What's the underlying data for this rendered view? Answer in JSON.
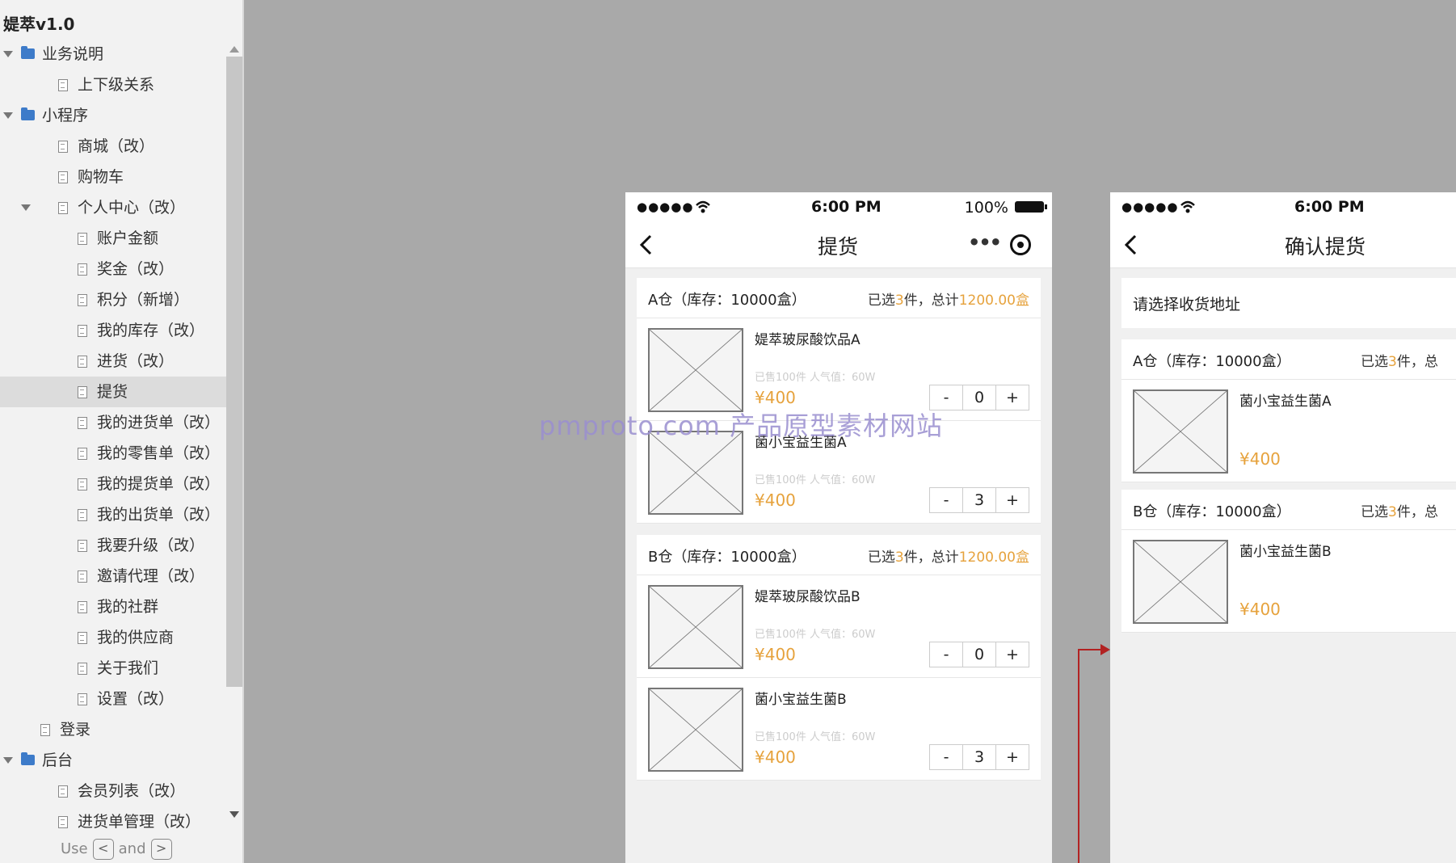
{
  "sidebar": {
    "title": "媞萃v1.0",
    "items": [
      {
        "label": "业务说明",
        "type": "folder",
        "level": 0,
        "expanded": true
      },
      {
        "label": "上下级关系",
        "type": "page",
        "level": 1
      },
      {
        "label": "小程序",
        "type": "folder",
        "level": 0,
        "expanded": true
      },
      {
        "label": "商城（改）",
        "type": "page",
        "level": 1
      },
      {
        "label": "购物车",
        "type": "page",
        "level": 1
      },
      {
        "label": "个人中心（改）",
        "type": "page",
        "level": 1,
        "expanded": true
      },
      {
        "label": "账户金额",
        "type": "page",
        "level": 2
      },
      {
        "label": "奖金（改）",
        "type": "page",
        "level": 2
      },
      {
        "label": "积分（新增）",
        "type": "page",
        "level": 2
      },
      {
        "label": "我的库存（改）",
        "type": "page",
        "level": 2
      },
      {
        "label": "进货（改）",
        "type": "page",
        "level": 2
      },
      {
        "label": "提货",
        "type": "page",
        "level": 2,
        "selected": true
      },
      {
        "label": "我的进货单（改）",
        "type": "page",
        "level": 2
      },
      {
        "label": "我的零售单（改）",
        "type": "page",
        "level": 2
      },
      {
        "label": "我的提货单（改）",
        "type": "page",
        "level": 2
      },
      {
        "label": "我的出货单（改）",
        "type": "page",
        "level": 2
      },
      {
        "label": "我要升级（改）",
        "type": "page",
        "level": 2
      },
      {
        "label": "邀请代理（改）",
        "type": "page",
        "level": 2
      },
      {
        "label": "我的社群",
        "type": "page",
        "level": 2
      },
      {
        "label": "我的供应商",
        "type": "page",
        "level": 2
      },
      {
        "label": "关于我们",
        "type": "page",
        "level": 2
      },
      {
        "label": "设置（改）",
        "type": "page",
        "level": 2
      },
      {
        "label": "登录",
        "type": "page",
        "level": 0
      },
      {
        "label": "后台",
        "type": "folder",
        "level": 0,
        "expanded": true
      },
      {
        "label": "会员列表（改）",
        "type": "page",
        "level": 1
      },
      {
        "label": "进货单管理（改）",
        "type": "page",
        "level": 1
      }
    ],
    "footer": {
      "use": "Use",
      "and": "and",
      "key_prev": "<",
      "key_next": ">"
    }
  },
  "phone1": {
    "status": {
      "dots": "●●●●●",
      "time": "6:00 PM",
      "battery": "100%"
    },
    "title": "提货",
    "more_glyph": "•••",
    "sections": [
      {
        "warehouse": "A仓（库存：10000盒）",
        "summary_pre": "已选",
        "summary_count": "3",
        "summary_mid": "件，总计",
        "summary_total": "1200.00盒",
        "products": [
          {
            "name": "媞萃玻尿酸饮品A",
            "meta": "已售100件   人气值：60W",
            "price": "¥400",
            "qty": "0",
            "minus": "-",
            "plus": "+"
          },
          {
            "name": "菌小宝益生菌A",
            "meta": "已售100件   人气值：60W",
            "price": "¥400",
            "qty": "3",
            "minus": "-",
            "plus": "+"
          }
        ]
      },
      {
        "warehouse": "B仓（库存：10000盒）",
        "summary_pre": "已选",
        "summary_count": "3",
        "summary_mid": "件，总计",
        "summary_total": "1200.00盒",
        "products": [
          {
            "name": "媞萃玻尿酸饮品B",
            "meta": "已售100件   人气值：60W",
            "price": "¥400",
            "qty": "0",
            "minus": "-",
            "plus": "+"
          },
          {
            "name": "菌小宝益生菌B",
            "meta": "已售100件   人气值：60W",
            "price": "¥400",
            "qty": "3",
            "minus": "-",
            "plus": "+"
          }
        ]
      }
    ]
  },
  "phone2": {
    "status": {
      "dots": "●●●●●",
      "time": "6:00 PM"
    },
    "title": "确认提货",
    "address_prompt": "请选择收货地址",
    "sections": [
      {
        "warehouse": "A仓（库存：10000盒）",
        "summary_pre": "已选",
        "summary_count": "3",
        "summary_mid": "件，总",
        "product": {
          "name": "菌小宝益生菌A",
          "price": "¥400"
        }
      },
      {
        "warehouse": "B仓（库存：10000盒）",
        "summary_pre": "已选",
        "summary_count": "3",
        "summary_mid": "件，总",
        "product": {
          "name": "菌小宝益生菌B",
          "price": "¥400"
        }
      }
    ]
  },
  "watermark": "pmproto.com 产品原型素材网站",
  "colors": {
    "accent": "#e6a23c",
    "folder": "#3d7bc9",
    "connector": "#b22222",
    "canvas": "#a9a9a9"
  }
}
